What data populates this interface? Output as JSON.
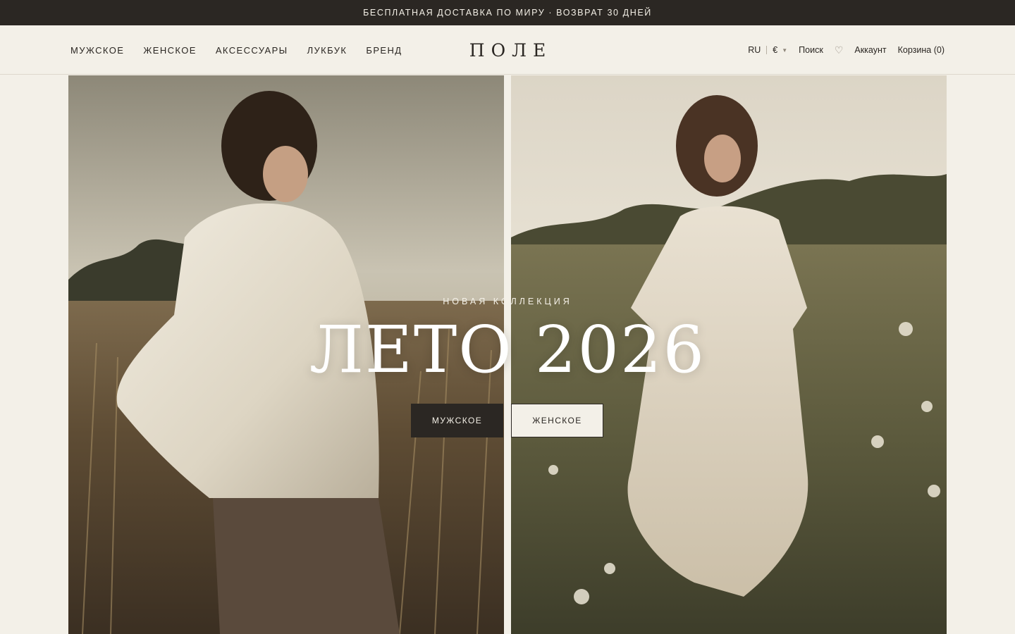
{
  "announcement": "БЕСПЛАТНАЯ ДОСТАВКА ПО МИРУ · ВОЗВРАТ 30 ДНЕЙ",
  "nav": {
    "items": [
      "МУЖСКОЕ",
      "ЖЕНСКОЕ",
      "АКСЕССУАРЫ",
      "ЛУКБУК",
      "БРЕНД"
    ]
  },
  "logo": "ПОЛЕ",
  "utils": {
    "language": "RU",
    "currency": "€",
    "search": "Поиск",
    "wishlist_icon": "heart-icon",
    "account": "Аккаунт",
    "cart": "Корзина (0)"
  },
  "hero": {
    "eyebrow": "НОВАЯ КОЛЛЕКЦИЯ",
    "headline": "ЛЕТО 2026",
    "buttons": {
      "men": "МУЖСКОЕ",
      "women": "ЖЕНСКОЕ"
    }
  },
  "colors": {
    "background": "#f3f0e8",
    "dark": "#2b2723",
    "light_text": "#f3efe6"
  }
}
